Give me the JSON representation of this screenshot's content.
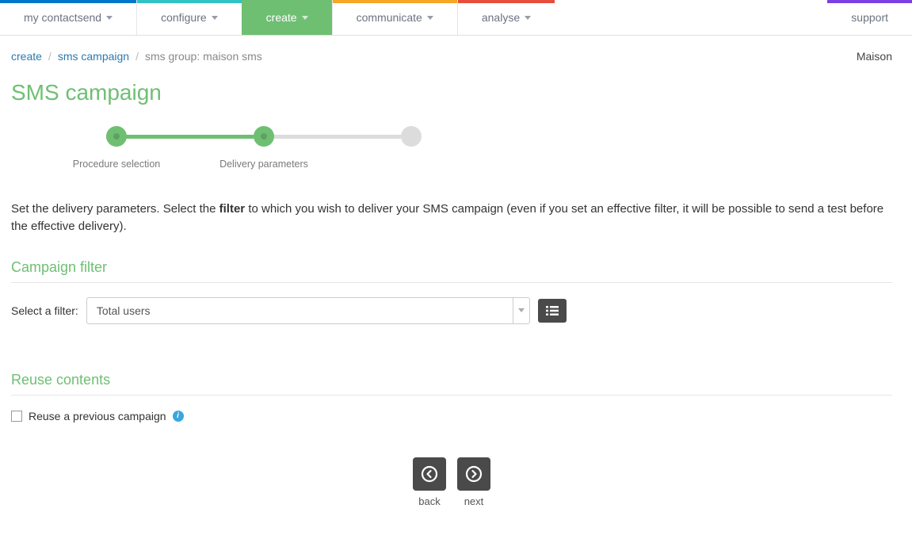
{
  "topnav": {
    "my_contactsend": "my contactsend",
    "configure": "configure",
    "create": "create",
    "communicate": "communicate",
    "analyse": "analyse",
    "support": "support"
  },
  "breadcrumbs": {
    "item1": "create",
    "item2": "sms campaign",
    "item3": "sms group: maison sms",
    "user": "Maison"
  },
  "page_title": "SMS campaign",
  "wizard": {
    "step1": "Procedure selection",
    "step2": "Delivery parameters"
  },
  "instruction": {
    "pre": "Set the delivery parameters. Select the ",
    "bold": "filter",
    "post": " to which you wish to deliver your SMS campaign (even if you set an effective filter, it will be possible to send a test before the effective delivery)."
  },
  "sections": {
    "campaign_filter_title": "Campaign filter",
    "reuse_contents_title": "Reuse contents"
  },
  "filter": {
    "label": "Select a filter:",
    "selected": "Total users"
  },
  "reuse": {
    "label": "Reuse a previous campaign"
  },
  "navbuttons": {
    "back": "back",
    "next": "next"
  }
}
